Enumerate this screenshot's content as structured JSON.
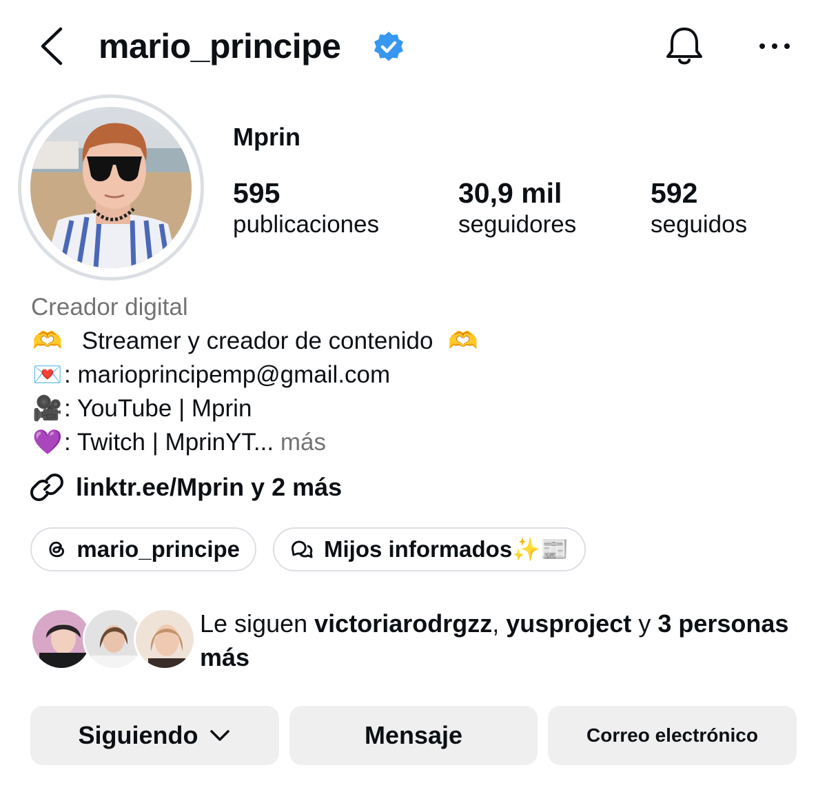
{
  "header": {
    "username": "mario_principe",
    "verified": true
  },
  "profile": {
    "display_name": "Mprin",
    "stats": [
      {
        "value": "595",
        "label": "publicaciones"
      },
      {
        "value": "30,9 mil",
        "label": "seguidores"
      },
      {
        "value": "592",
        "label": "seguidos"
      }
    ],
    "category": "Creador digital",
    "bio": [
      {
        "icon": "🫶",
        "text": "Streamer y creador de contenido",
        "trailing_icon": "🫶"
      },
      {
        "icon": "💌",
        "text": ": marioprincipemp@gmail.com"
      },
      {
        "icon": "🎥",
        "text": ": YouTube | Mprin"
      },
      {
        "icon": "💜",
        "text": ": Twitch | MprinYT...",
        "more": "más"
      }
    ],
    "links_text": "linktr.ee/Mprin y 2 más",
    "pills": {
      "threads": "mario_principe",
      "channel": "Mijos informados✨📰"
    },
    "followed_by": {
      "prefix": "Le siguen",
      "user1": "victoriarodrgzz",
      "sep": ",",
      "user2": "yusproject",
      "conj": "y",
      "rest": "3 personas más"
    }
  },
  "actions": {
    "following": "Siguiendo",
    "message": "Mensaje",
    "email": "Correo electrónico"
  },
  "colors": {
    "verified": "#3897f0",
    "muted": "#737373",
    "button_bg": "#efefef",
    "border": "#dbdfe4"
  }
}
